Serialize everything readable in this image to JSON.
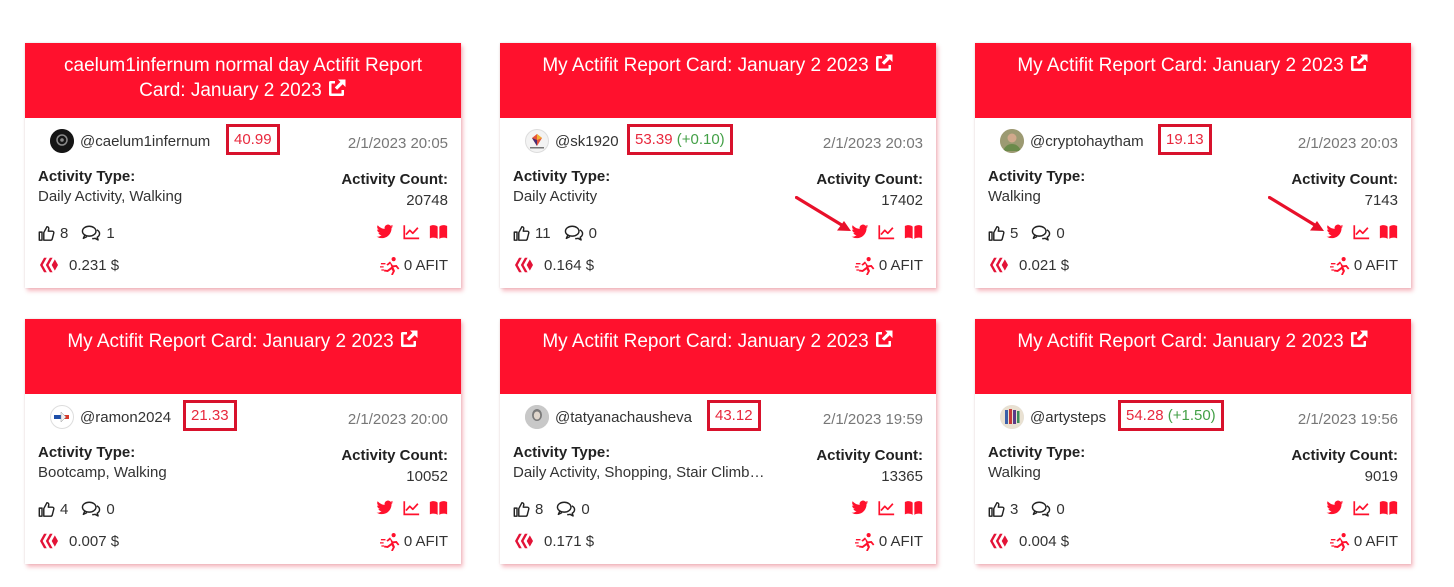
{
  "colors": {
    "brand_red": "#ff112d",
    "box_red": "#d8122c",
    "plus_green": "#43a047"
  },
  "icons": {
    "external": "external-link-icon",
    "like": "thumbs-up-icon",
    "comment": "comment-icon",
    "twitter": "twitter-icon",
    "chart": "chart-line-icon",
    "book": "book-icon",
    "hive": "hive-icon",
    "afit": "runner-icon",
    "arrow": "red-arrow-icon"
  },
  "cards": [
    {
      "title": "caelum1infernum normal day Actifit Report Card: January 2 2023",
      "username": "@caelum1infernum",
      "rank": "40.99",
      "rank_plus": "",
      "date": "2/1/2023 20:05",
      "activity_type_label": "Activity Type:",
      "activity_type": "Daily Activity, Walking",
      "activity_count_label": "Activity Count:",
      "activity_count": "20748",
      "likes": "8",
      "comments": "1",
      "payout": "0.231 $",
      "afit": "0 AFIT"
    },
    {
      "title": "My Actifit Report Card: January 2 2023",
      "username": "@sk1920",
      "rank": "53.39",
      "rank_plus": "(+0.10)",
      "date": "2/1/2023 20:03",
      "activity_type_label": "Activity Type:",
      "activity_type": "Daily Activity",
      "activity_count_label": "Activity Count:",
      "activity_count": "17402",
      "likes": "11",
      "comments": "0",
      "payout": "0.164 $",
      "afit": "0 AFIT"
    },
    {
      "title": "My Actifit Report Card: January 2 2023",
      "username": "@cryptohaytham",
      "rank": "19.13",
      "rank_plus": "",
      "date": "2/1/2023 20:03",
      "activity_type_label": "Activity Type:",
      "activity_type": "Walking",
      "activity_count_label": "Activity Count:",
      "activity_count": "7143",
      "likes": "5",
      "comments": "0",
      "payout": "0.021 $",
      "afit": "0 AFIT"
    },
    {
      "title": "My Actifit Report Card: January 2 2023",
      "username": "@ramon2024",
      "rank": "21.33",
      "rank_plus": "",
      "date": "2/1/2023 20:00",
      "activity_type_label": "Activity Type:",
      "activity_type": "Bootcamp, Walking",
      "activity_count_label": "Activity Count:",
      "activity_count": "10052",
      "likes": "4",
      "comments": "0",
      "payout": "0.007 $",
      "afit": "0 AFIT"
    },
    {
      "title": "My Actifit Report Card: January 2 2023",
      "username": "@tatyanachausheva",
      "rank": "43.12",
      "rank_plus": "",
      "date": "2/1/2023 19:59",
      "activity_type_label": "Activity Type:",
      "activity_type": "Daily Activity, Shopping, Stair Climb…",
      "activity_count_label": "Activity Count:",
      "activity_count": "13365",
      "likes": "8",
      "comments": "0",
      "payout": "0.171 $",
      "afit": "0 AFIT"
    },
    {
      "title": "My Actifit Report Card: January 2 2023",
      "username": "@artysteps",
      "rank": "54.28",
      "rank_plus": "(+1.50)",
      "date": "2/1/2023 19:56",
      "activity_type_label": "Activity Type:",
      "activity_type": "Walking",
      "activity_count_label": "Activity Count:",
      "activity_count": "9019",
      "likes": "3",
      "comments": "0",
      "payout": "0.004 $",
      "afit": "0 AFIT"
    }
  ]
}
